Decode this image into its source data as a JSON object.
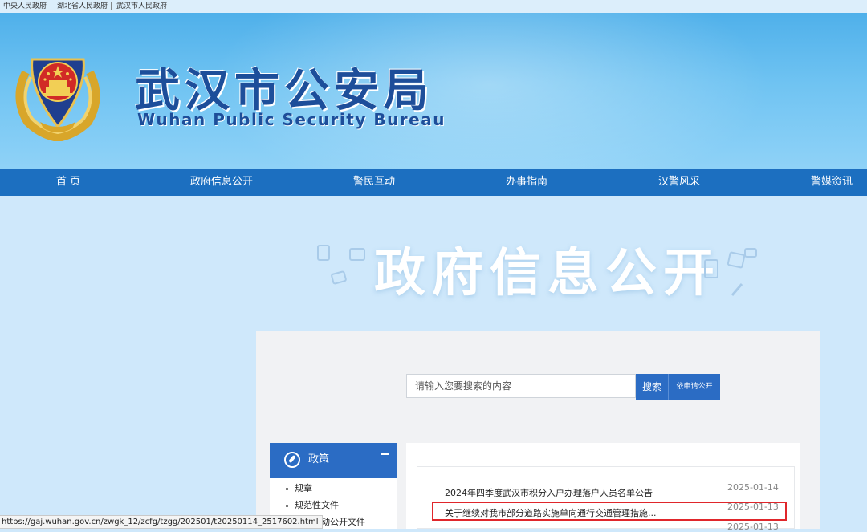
{
  "topbar": {
    "links": [
      "中央人民政府",
      "湖北省人民政府",
      "武汉市人民政府"
    ],
    "separator": "|"
  },
  "header": {
    "title_cn": "武汉市公安局",
    "title_en": "Wuhan Public Security Bureau"
  },
  "nav": {
    "items": [
      "首 页",
      "政府信息公开",
      "警民互动",
      "办事指南",
      "汉警风采",
      "警媒资讯"
    ]
  },
  "banner": {
    "title": "政府信息公开"
  },
  "search": {
    "placeholder": "请输入您要搜索的内容",
    "button_label": "搜索",
    "apply_label": "依申请公开"
  },
  "sidebar": {
    "heading": "政策",
    "items": [
      "规章",
      "规范性文件",
      "其他主动公开文件"
    ]
  },
  "list": {
    "items": [
      {
        "title": "2024年四季度武汉市积分入户办理落户人员名单公告",
        "date": "2025-01-14"
      },
      {
        "title": "关于继续对我市部分道路实施单向通行交通管理措施...",
        "date": "2025-01-13"
      },
      {
        "title": "",
        "date": "2025-01-13"
      }
    ]
  },
  "status_url": "https://gaj.wuhan.gov.cn/zwgk_12/zcfg/tzgg/202501/t20250114_2517602.html",
  "colors": {
    "nav_blue": "#1c6fc0",
    "button_blue": "#2b6cc4",
    "title_blue": "#1d4e9a",
    "highlight_red": "#e0262b"
  }
}
